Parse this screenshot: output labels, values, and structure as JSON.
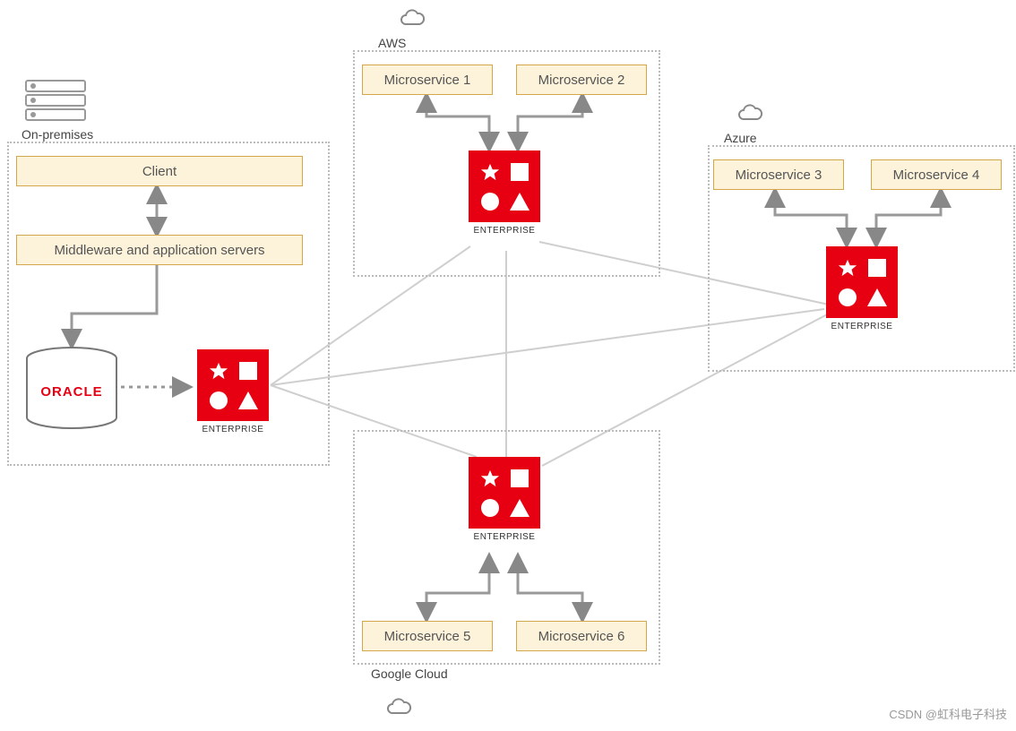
{
  "groups": {
    "onprem": {
      "label": "On-premises"
    },
    "aws": {
      "label": "AWS"
    },
    "azure": {
      "label": "Azure"
    },
    "gcloud": {
      "label": "Google Cloud"
    }
  },
  "boxes": {
    "client": "Client",
    "middleware": "Middleware and application servers",
    "ms1": "Microservice 1",
    "ms2": "Microservice 2",
    "ms3": "Microservice 3",
    "ms4": "Microservice 4",
    "ms5": "Microservice 5",
    "ms6": "Microservice 6"
  },
  "enterprise_label": "ENTERPRISE",
  "oracle_label": "ORACLE",
  "watermark": "CSDN @虹科电子科技",
  "icons": {
    "server_stack": "server-stack-icon",
    "cloud": "cloud-icon",
    "star": "star-icon",
    "square": "square-icon",
    "circle": "circle-icon",
    "triangle": "triangle-icon"
  },
  "diagram": {
    "description": "Hybrid multi-cloud architecture with on-premises system connected via Enterprise nodes to AWS, Azure, and Google Cloud; each cloud hosts two microservices.",
    "nodes": [
      {
        "id": "onprem.client",
        "type": "box"
      },
      {
        "id": "onprem.middleware",
        "type": "box"
      },
      {
        "id": "onprem.oracle",
        "type": "database"
      },
      {
        "id": "onprem.enterprise",
        "type": "enterprise"
      },
      {
        "id": "aws.ms1",
        "type": "box"
      },
      {
        "id": "aws.ms2",
        "type": "box"
      },
      {
        "id": "aws.enterprise",
        "type": "enterprise"
      },
      {
        "id": "azure.ms3",
        "type": "box"
      },
      {
        "id": "azure.ms4",
        "type": "box"
      },
      {
        "id": "azure.enterprise",
        "type": "enterprise"
      },
      {
        "id": "gcloud.ms5",
        "type": "box"
      },
      {
        "id": "gcloud.ms6",
        "type": "box"
      },
      {
        "id": "gcloud.enterprise",
        "type": "enterprise"
      }
    ],
    "edges": [
      {
        "from": "onprem.client",
        "to": "onprem.middleware",
        "style": "bidirectional"
      },
      {
        "from": "onprem.middleware",
        "to": "onprem.oracle",
        "style": "elbow-arrow-to"
      },
      {
        "from": "onprem.oracle",
        "to": "onprem.enterprise",
        "style": "dotted-arrow"
      },
      {
        "from": "aws.enterprise",
        "to": "aws.ms1",
        "style": "elbow-bidirectional"
      },
      {
        "from": "aws.enterprise",
        "to": "aws.ms2",
        "style": "elbow-bidirectional"
      },
      {
        "from": "azure.enterprise",
        "to": "azure.ms3",
        "style": "elbow-bidirectional"
      },
      {
        "from": "azure.enterprise",
        "to": "azure.ms4",
        "style": "elbow-bidirectional"
      },
      {
        "from": "gcloud.enterprise",
        "to": "gcloud.ms5",
        "style": "elbow-bidirectional"
      },
      {
        "from": "gcloud.enterprise",
        "to": "gcloud.ms6",
        "style": "elbow-bidirectional"
      },
      {
        "from": "onprem.enterprise",
        "to": "aws.enterprise",
        "style": "line"
      },
      {
        "from": "onprem.enterprise",
        "to": "azure.enterprise",
        "style": "line"
      },
      {
        "from": "onprem.enterprise",
        "to": "gcloud.enterprise",
        "style": "line"
      },
      {
        "from": "aws.enterprise",
        "to": "azure.enterprise",
        "style": "line"
      },
      {
        "from": "aws.enterprise",
        "to": "gcloud.enterprise",
        "style": "line"
      },
      {
        "from": "azure.enterprise",
        "to": "gcloud.enterprise",
        "style": "line"
      }
    ]
  }
}
